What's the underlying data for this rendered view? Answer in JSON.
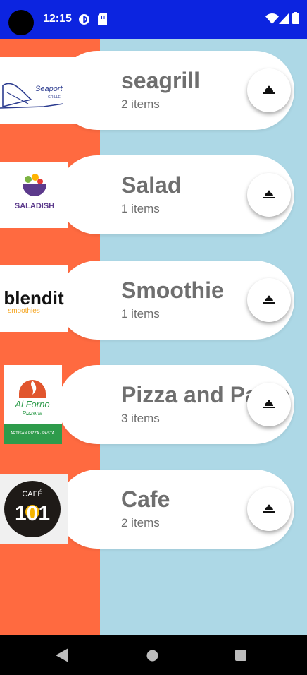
{
  "status_bar": {
    "time": "12:15",
    "icons": [
      "camera-cutout",
      "data-saver-icon",
      "sim-card-icon",
      "wifi-icon",
      "signal-icon",
      "battery-icon"
    ]
  },
  "colors": {
    "status_bar": "#0C24E0",
    "left_panel": "#FF6A40",
    "background": "#ADD8E6",
    "card": "#FFFFFF",
    "text": "#6F6F6F"
  },
  "stores": [
    {
      "name": "seagrill",
      "count": "2 items",
      "logo": "seaport-grill-logo",
      "logo_text": "Seaport",
      "logo_sub": "GRILLE"
    },
    {
      "name": "Salad",
      "count": "1 items",
      "logo": "saladish-logo",
      "logo_text": "SALADISH"
    },
    {
      "name": "Smoothie",
      "count": "1 items",
      "logo": "blendit-logo",
      "logo_text": "blendit",
      "logo_sub": "smoothies"
    },
    {
      "name": "Pizza and Pasta",
      "count": "3 items",
      "logo": "al-forno-logo",
      "logo_text": "Al Forno",
      "logo_sub": "Pizzeria",
      "logo_band": "ARTISAN PIZZA · PASTA"
    },
    {
      "name": "Cafe",
      "count": "2 items",
      "logo": "cafe-101-logo",
      "logo_text": "CAFÉ",
      "logo_sub": "101"
    }
  ],
  "nav": {
    "icons": [
      "back-icon",
      "home-icon",
      "recents-icon"
    ]
  }
}
